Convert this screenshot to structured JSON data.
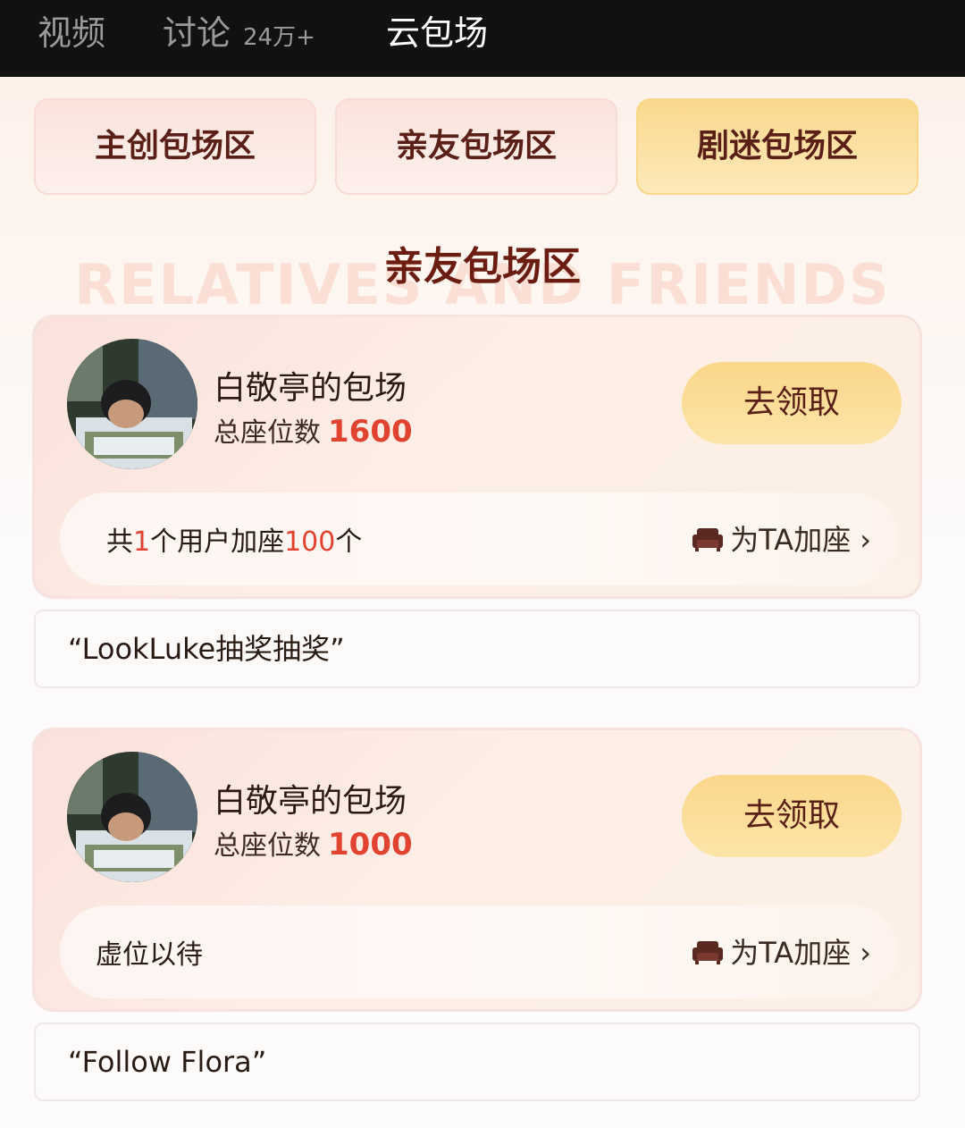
{
  "top_tabs": [
    {
      "label": "视频",
      "count": ""
    },
    {
      "label": "讨论",
      "count": "24万+"
    },
    {
      "label": "云包场",
      "count": ""
    }
  ],
  "zones": [
    "主创包场区",
    "亲友包场区",
    "剧迷包场区"
  ],
  "selected_zone_index": 2,
  "section": {
    "title": "亲友包场区",
    "watermark": "RELATIVES AND FRIENDS"
  },
  "cards": [
    {
      "owner": "白敬亭的包场",
      "seats_label": "总座位数",
      "seats": "1600",
      "claim_label": "去领取",
      "info_parts": [
        "共",
        "1",
        "个用户加座",
        "100",
        "个"
      ],
      "add_seat_label": "为TA加座",
      "message": "“LookLuke抽奖抽奖”"
    },
    {
      "owner": "白敬亭的包场",
      "seats_label": "总座位数",
      "seats": "1000",
      "claim_label": "去领取",
      "info_parts": [
        "虚位以待"
      ],
      "add_seat_label": "为TA加座",
      "message": "“Follow Flora”"
    }
  ],
  "icons": {
    "avatar": "avatar-photo",
    "add_seat": "sofa-icon",
    "chevron": "chevron-right-icon"
  },
  "colors": {
    "accent_red": "#e0432f",
    "gold_button": "#fbd78a",
    "header_bg": "#111111"
  }
}
